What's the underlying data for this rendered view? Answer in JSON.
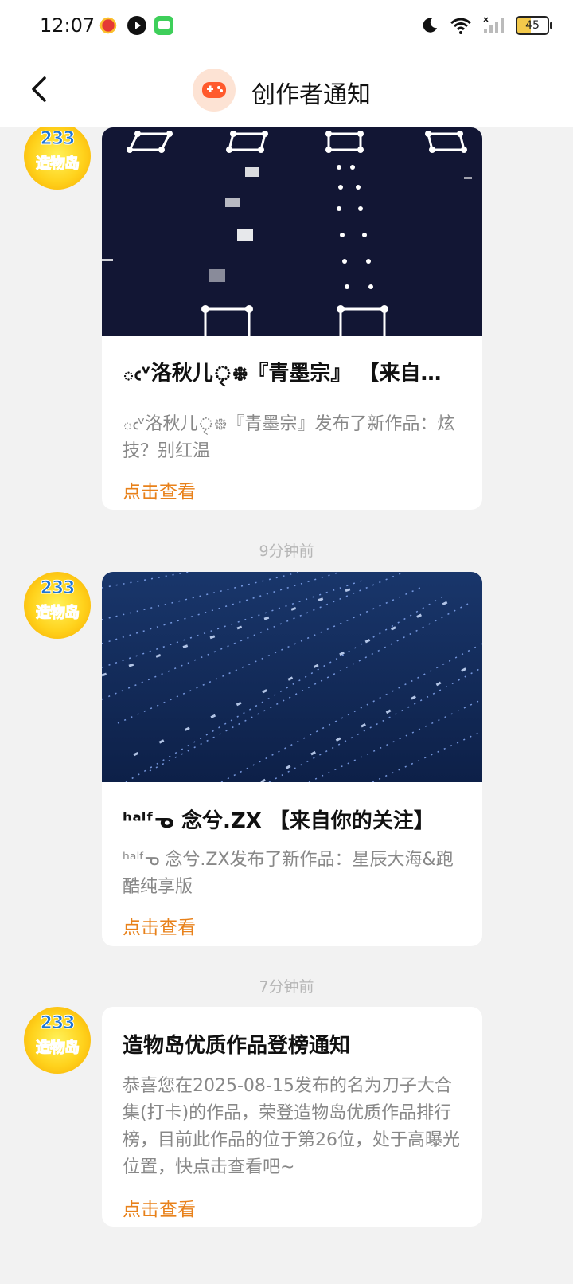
{
  "status_bar": {
    "time": "12:07",
    "battery": "45"
  },
  "header": {
    "title": "创作者通知"
  },
  "avatar": {
    "number": "233",
    "name": "造物岛"
  },
  "notifications": [
    {
      "title": "ఁᵛ洛秋儿ৃ᪥『青墨宗』 【来自你的关注】",
      "desc": "ఁᵛ洛秋儿ৃ᪥『青墨宗』发布了新作品：炫技？别红温",
      "link": "点击查看"
    },
    {
      "time": "9分钟前",
      "title": "ʰᵃˡᶠᓀ 念兮.ZX 【来自你的关注】",
      "desc": "ʰᵃˡᶠᓀ 念兮.ZX发布了新作品：星辰大海&跑酷纯享版",
      "link": "点击查看"
    },
    {
      "time": "7分钟前",
      "title": "造物岛优质作品登榜通知",
      "desc": "恭喜您在2025-08-15发布的名为刀子大合集(打卡)的作品，荣登造物岛优质作品排行榜，目前此作品的位于第26位，处于高曝光位置，快点击查看吧~",
      "link": "点击查看"
    }
  ]
}
